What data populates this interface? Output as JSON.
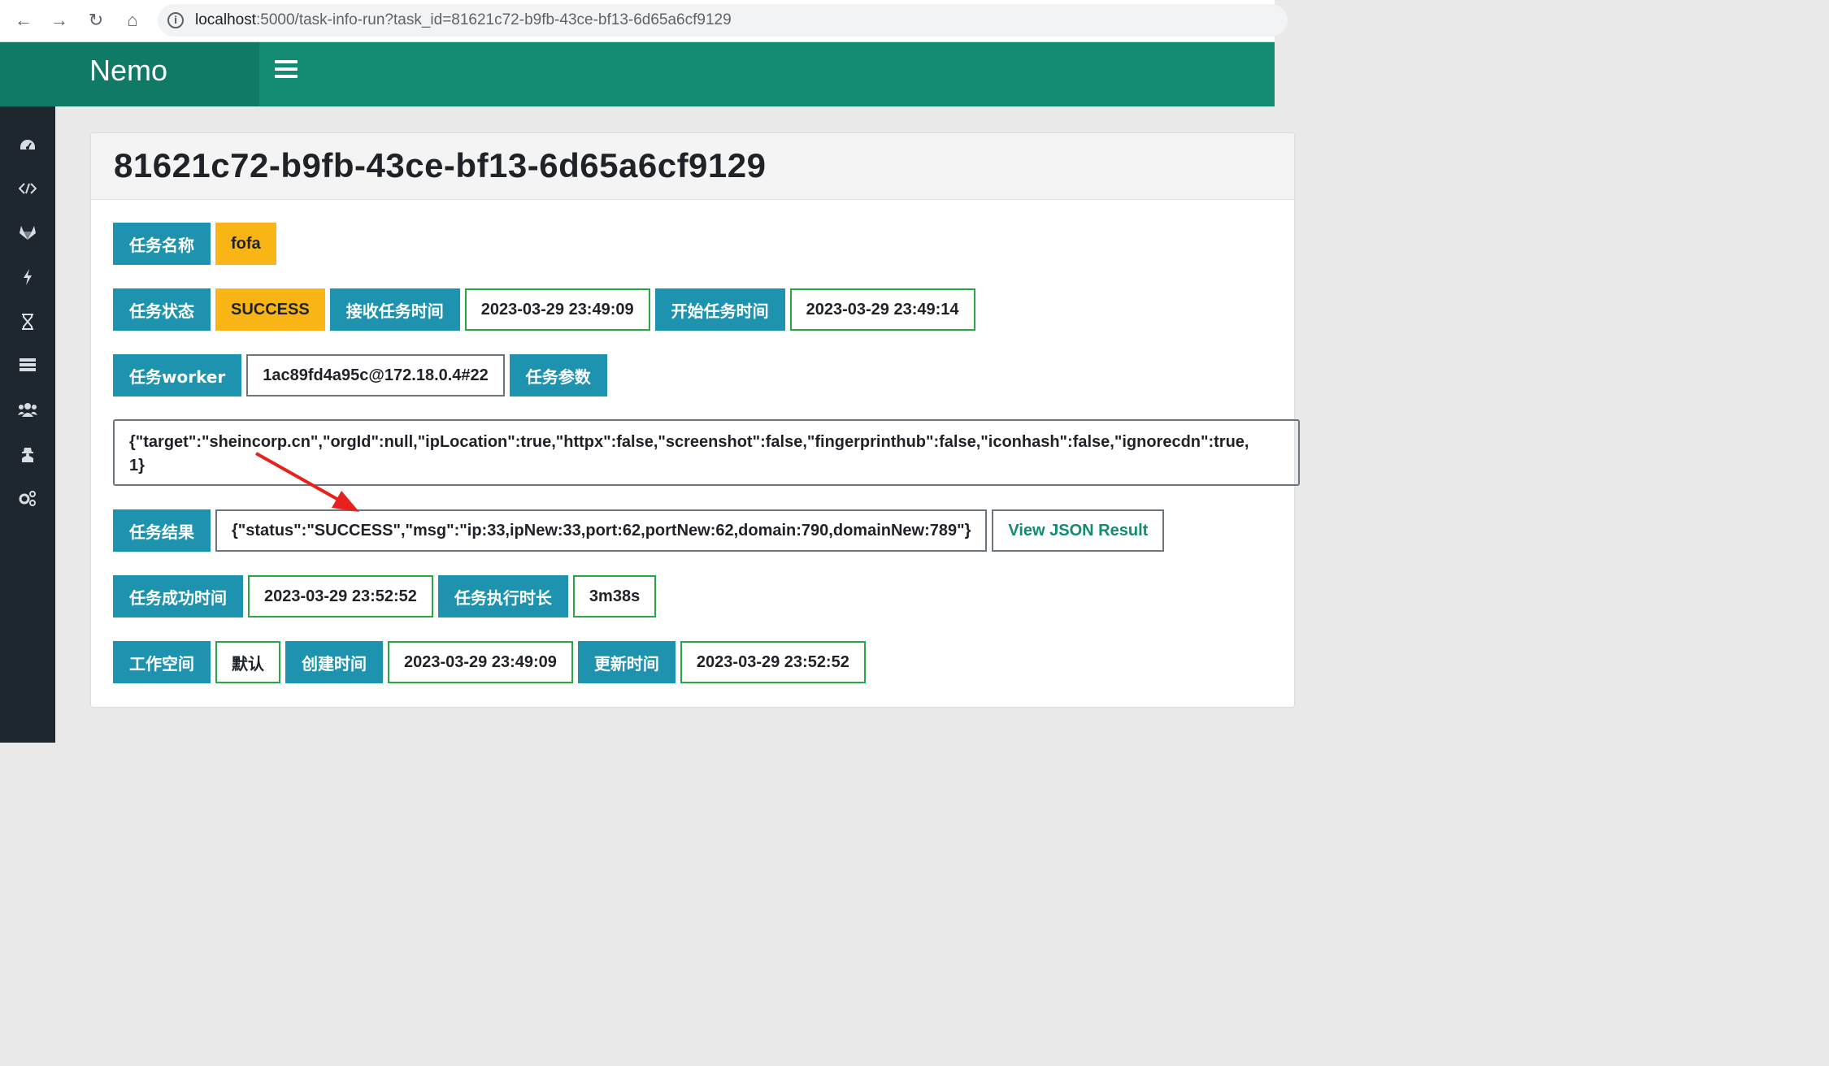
{
  "browser": {
    "url_host": "localhost",
    "url_path": ":5000/task-info-run?task_id=81621c72-b9fb-43ce-bf13-6d65a6cf9129"
  },
  "app": {
    "brand": "Nemo"
  },
  "sidebar": {
    "icons": [
      "dashboard-icon",
      "code-icon",
      "gitlab-icon",
      "bolt-icon",
      "hourglass-icon",
      "server-icon",
      "users-icon",
      "user-secret-icon",
      "cogs-icon"
    ]
  },
  "task": {
    "id_title": "81621c72-b9fb-43ce-bf13-6d65a6cf9129",
    "name_label": "任务名称",
    "name_value": "fofa",
    "status_label": "任务状态",
    "status_value": "SUCCESS",
    "received_label": "接收任务时间",
    "received_value": "2023-03-29 23:49:09",
    "started_label": "开始任务时间",
    "started_value": "2023-03-29 23:49:14",
    "worker_label": "任务worker",
    "worker_value": "1ac89fd4a95c@172.18.0.4#22",
    "params_label": "任务参数",
    "params_line1": "{\"target\":\"sheincorp.cn\",\"orgId\":null,\"ipLocation\":true,\"httpx\":false,\"screenshot\":false,\"fingerprinthub\":false,\"iconhash\":false,\"ignorecdn\":true,",
    "params_line2": "1}",
    "result_label": "任务结果",
    "result_value": "{\"status\":\"SUCCESS\",\"msg\":\"ip:33,ipNew:33,port:62,portNew:62,domain:790,domainNew:789\"}",
    "json_button": "View JSON Result",
    "success_time_label": "任务成功时间",
    "success_time_value": "2023-03-29 23:52:52",
    "duration_label": "任务执行时长",
    "duration_value": "3m38s",
    "workspace_label": "工作空间",
    "workspace_value": "默认",
    "created_label": "创建时间",
    "created_value": "2023-03-29 23:49:09",
    "updated_label": "更新时间",
    "updated_value": "2023-03-29 23:52:52"
  },
  "colors": {
    "brand": "#138a72",
    "label_bg": "#1d93b0",
    "highlight": "#f9b515",
    "value_border": "#28a745",
    "annotation_arrow": "#e8211d"
  }
}
